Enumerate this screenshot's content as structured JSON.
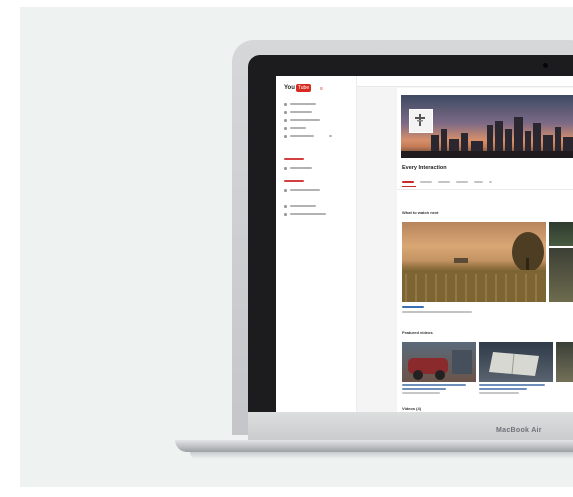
{
  "device": {
    "brand_label": "MacBook Air"
  },
  "youtube": {
    "logo": {
      "you": "You",
      "tube": "Tube"
    },
    "channel": {
      "name": "Every Interaction"
    },
    "sections": {
      "what_to_watch": "What to watch next",
      "featured_videos": "Featured videos",
      "videos": "Videos (4)"
    }
  },
  "colors": {
    "accent_red": "#cc2a2a",
    "link_blue": "#3b6fb4",
    "panel_bg": "#eef2f1"
  },
  "icons": [
    "menu-icon",
    "avatar-icon",
    "laptop-camera"
  ]
}
